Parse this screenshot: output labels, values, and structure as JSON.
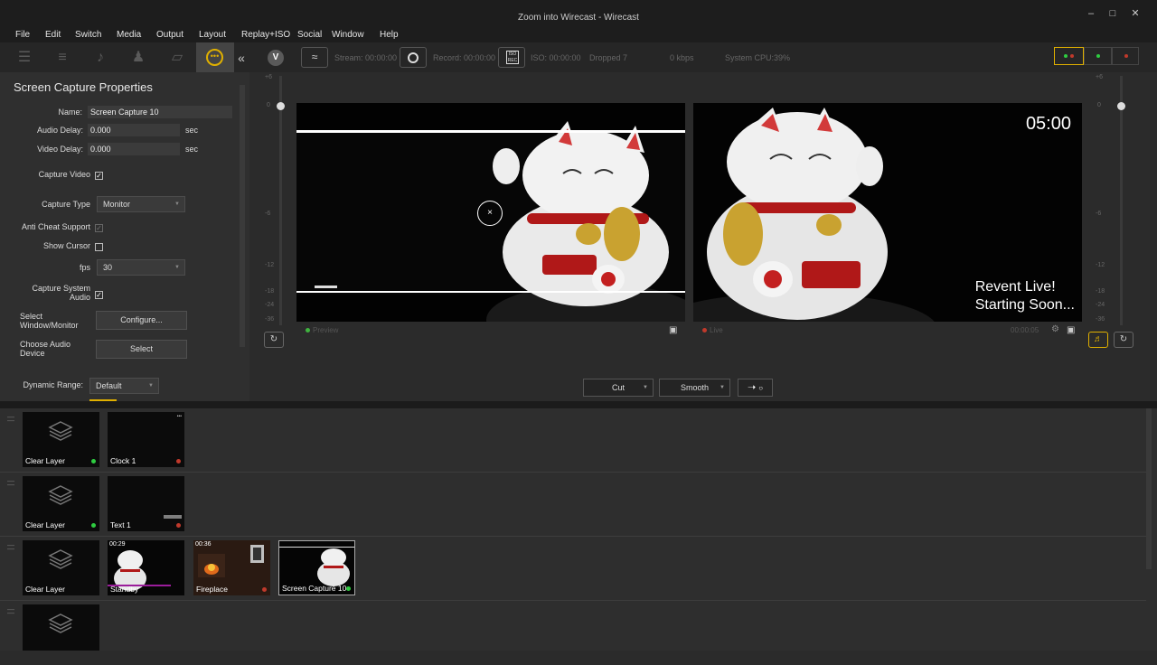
{
  "window": {
    "title": "Zoom into Wirecast - Wirecast"
  },
  "menu": [
    "File",
    "Edit",
    "Switch",
    "Media",
    "Output",
    "Layout",
    "Replay+ISO",
    "Social",
    "Window",
    "Help"
  ],
  "toolbar": {
    "stream_label": "Stream: 00:00:00",
    "record_label": "Record: 00:00:00",
    "iso_badge": "ISO REC",
    "iso_label": "ISO: 00:00:00",
    "dropped_label": "Dropped 7",
    "kbps_label": "0 kbps",
    "cpu_label": "System CPU:39%"
  },
  "properties": {
    "title": "Screen Capture Properties",
    "name_label": "Name:",
    "name_value": "Screen Capture 10",
    "audio_delay_label": "Audio Delay:",
    "audio_delay_value": "0.000",
    "video_delay_label": "Video Delay:",
    "video_delay_value": "0.000",
    "sec_unit": "sec",
    "capture_video_label": "Capture Video",
    "capture_type_label": "Capture Type",
    "capture_type_value": "Monitor",
    "anti_cheat_label": "Anti Cheat Support",
    "show_cursor_label": "Show Cursor",
    "fps_label": "fps",
    "fps_value": "30",
    "capture_audio_label_1": "Capture System",
    "capture_audio_label_2": "Audio",
    "select_window_label_1": "Select",
    "select_window_label_2": "Window/Monitor",
    "configure_button": "Configure...",
    "audio_device_label_1": "Choose Audio",
    "audio_device_label_2": "Device",
    "select_button": "Select",
    "dynamic_range_label": "Dynamic Range:",
    "dynamic_range_value": "Default"
  },
  "meter_ticks": [
    "+6",
    "0",
    "-6",
    "-12",
    "-18",
    "-24",
    "-36"
  ],
  "preview": {
    "caption": "Preview",
    "status_color": "#3fb43f"
  },
  "live": {
    "caption": "Live",
    "status_color": "#c0392b",
    "timer_overlay": "05:00",
    "overlay_line1": "Revent Live!",
    "overlay_line2": "Starting Soon...",
    "elapsed": "00:00:05"
  },
  "transitions": {
    "cut_label": "Cut",
    "smooth_label": "Smooth",
    "go_icon": "arrow-right-icon"
  },
  "shots": {
    "row1": [
      {
        "label": "Clear Layer",
        "dot": "#2ecc40"
      },
      {
        "label": "Clock 1",
        "dot": "#c0392b"
      }
    ],
    "row2": [
      {
        "label": "Clear Layer",
        "dot": "#2ecc40"
      },
      {
        "label": "Text 1",
        "dot": "#c0392b"
      }
    ],
    "row3": [
      {
        "label": "Clear Layer",
        "dot": ""
      },
      {
        "label": "Standby",
        "time": "00:29",
        "dot": ""
      },
      {
        "label": "Fireplace",
        "time": "00:36",
        "dot": "#c0392b"
      },
      {
        "label": "Screen Capture 10",
        "dot": "#2ecc40"
      }
    ]
  },
  "colors": {
    "accent": "#e0b000",
    "panel": "#2f2f2f"
  }
}
